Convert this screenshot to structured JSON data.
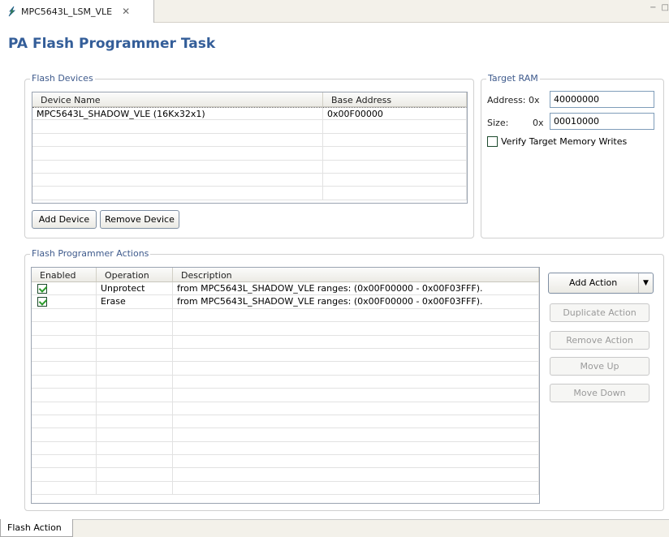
{
  "editor_tab": {
    "title": "MPC5643L_LSM_VLE",
    "close_glyph": "✕"
  },
  "window_controls": {
    "minimize": "−",
    "maximize": "□"
  },
  "page_title": "PA Flash Programmer Task",
  "flash_devices": {
    "group_title": "Flash Devices",
    "columns": [
      "Device Name",
      "Base Address"
    ],
    "rows": [
      {
        "name": "MPC5643L_SHADOW_VLE (16Kx32x1)",
        "address": "0x00F00000"
      }
    ],
    "add_button": "Add Device",
    "remove_button": "Remove Device"
  },
  "target_ram": {
    "group_title": "Target RAM",
    "address_label": "Address: 0x",
    "address_value": "40000000",
    "size_label": "Size:",
    "size_prefix": "0x",
    "size_value": "00010000",
    "verify_label": "Verify Target Memory Writes",
    "verify_checked": false
  },
  "actions": {
    "group_title": "Flash Programmer Actions",
    "columns": [
      "Enabled",
      "Operation",
      "Description"
    ],
    "rows": [
      {
        "enabled": true,
        "operation": "Unprotect",
        "description": "from MPC5643L_SHADOW_VLE ranges: (0x00F00000 - 0x00F03FFF)."
      },
      {
        "enabled": true,
        "operation": "Erase",
        "description": "from MPC5643L_SHADOW_VLE ranges: (0x00F00000 - 0x00F03FFF)."
      }
    ],
    "add_action": "Add Action",
    "duplicate_action": "Duplicate Action",
    "remove_action": "Remove Action",
    "move_up": "Move Up",
    "move_down": "Move Down"
  },
  "bottom_tab": "Flash Action",
  "colors": {
    "title": "#345e99",
    "group_title": "#3e5a8c",
    "check": "#2a9a2a"
  }
}
